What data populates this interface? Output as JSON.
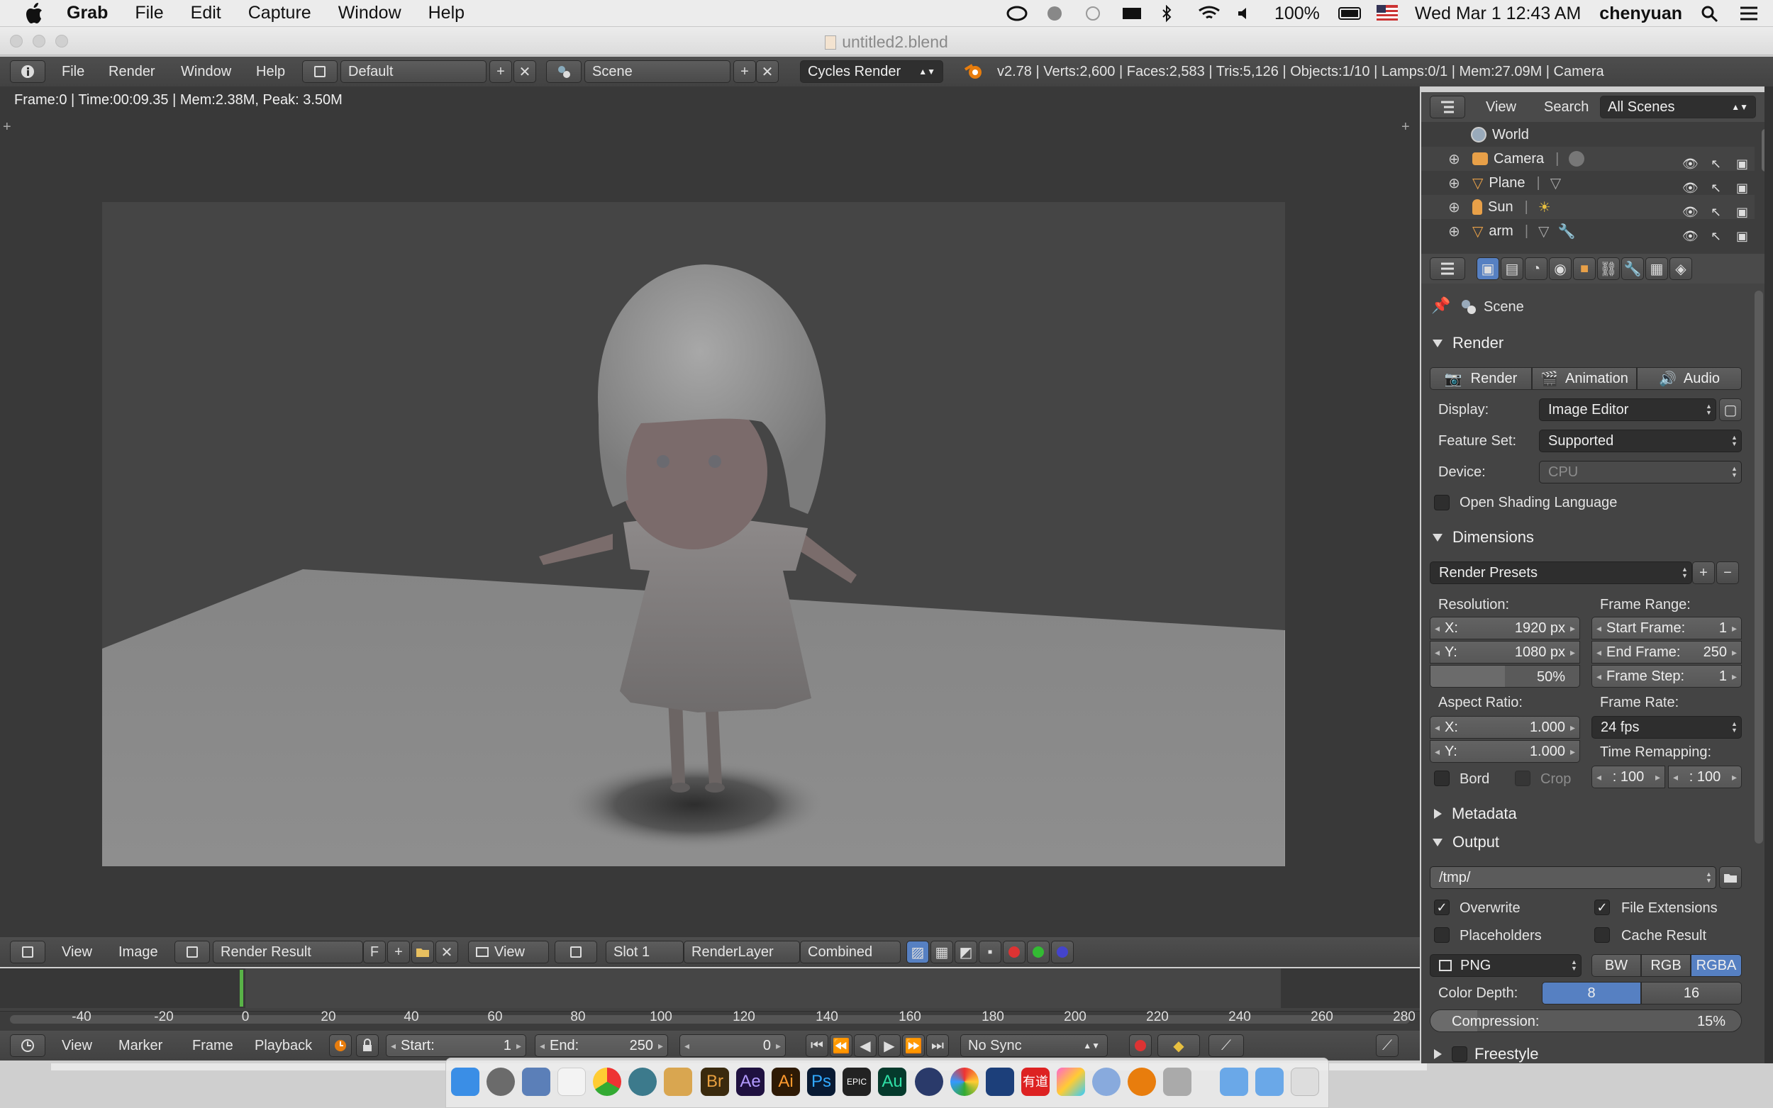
{
  "macos": {
    "app_name": "Grab",
    "menu": [
      "File",
      "Edit",
      "Capture",
      "Window",
      "Help"
    ],
    "battery": "100%",
    "datetime": "Wed Mar 1  12:43 AM",
    "user": "chenyuan"
  },
  "window": {
    "title": "untitled2.blend"
  },
  "info_header": {
    "menu": [
      "File",
      "Render",
      "Window",
      "Help"
    ],
    "layout": "Default",
    "scene": "Scene",
    "engine": "Cycles Render",
    "stats": "v2.78 | Verts:2,600 | Faces:2,583 | Tris:5,126 | Objects:1/10 | Lamps:0/1 | Mem:27.09M | Camera"
  },
  "viewport": {
    "render_info": "Frame:0 | Time:00:09.35 | Mem:2.38M, Peak: 3.50M"
  },
  "image_header": {
    "menu": [
      "View",
      "Image"
    ],
    "image_name": "Render Result",
    "fake_user": "F",
    "view": "View",
    "slot": "Slot 1",
    "layer": "RenderLayer",
    "pass": "Combined"
  },
  "outliner": {
    "header": {
      "view": "View",
      "search": "Search",
      "filter": "All Scenes"
    },
    "items": [
      {
        "label": "World"
      },
      {
        "label": "Camera"
      },
      {
        "label": "Plane"
      },
      {
        "label": "Sun"
      },
      {
        "label": "arm"
      }
    ]
  },
  "properties": {
    "context": "Scene",
    "render_panel": {
      "title": "Render",
      "buttons": [
        "Render",
        "Animation",
        "Audio"
      ],
      "display_label": "Display:",
      "display_value": "Image Editor",
      "feature_label": "Feature Set:",
      "feature_value": "Supported",
      "device_label": "Device:",
      "device_value": "CPU",
      "osl_label": "Open Shading Language"
    },
    "dimensions": {
      "title": "Dimensions",
      "presets": "Render Presets",
      "resolution_label": "Resolution:",
      "res_x_label": "X:",
      "res_x": "1920 px",
      "res_y_label": "Y:",
      "res_y": "1080 px",
      "res_percent": "50%",
      "frame_range_label": "Frame Range:",
      "start_label": "Start Frame:",
      "start": "1",
      "end_label": "End Frame:",
      "end": "250",
      "step_label": "Frame Step:",
      "step": "1",
      "aspect_label": "Aspect Ratio:",
      "asp_x_label": "X:",
      "asp_x": "1.000",
      "asp_y_label": "Y:",
      "asp_y": "1.000",
      "frame_rate_label": "Frame Rate:",
      "frame_rate": "24 fps",
      "remap_label": "Time Remapping:",
      "remap_old": ": 100",
      "remap_new": ": 100",
      "bord_label": "Bord",
      "crop_label": "Crop"
    },
    "metadata": {
      "title": "Metadata"
    },
    "output": {
      "title": "Output",
      "path": "/tmp/",
      "overwrite": "Overwrite",
      "file_ext": "File Extensions",
      "placeholders": "Placeholders",
      "cache": "Cache Result",
      "format": "PNG",
      "color_modes": [
        "BW",
        "RGB",
        "RGBA"
      ],
      "depth_label": "Color Depth:",
      "depths": [
        "8",
        "16"
      ],
      "compression_label": "Compression:",
      "compression_value": "15%",
      "compression_fraction": 0.15
    },
    "freestyle": {
      "title": "Freestyle"
    }
  },
  "timeline": {
    "ticks": [
      "-40",
      "-20",
      "0",
      "20",
      "40",
      "60",
      "80",
      "100",
      "120",
      "140",
      "160",
      "180",
      "200",
      "220",
      "240",
      "260",
      "280"
    ],
    "current_frame_marker": 0
  },
  "timeline_header": {
    "menu": [
      "View",
      "Marker",
      "Frame",
      "Playback"
    ],
    "start_label": "Start:",
    "start": "1",
    "end_label": "End:",
    "end": "250",
    "current": "0",
    "sync": "No Sync"
  },
  "colors": {
    "blender_bg": "#393939",
    "panel_bg": "#444444",
    "accent_blue": "#5680c2",
    "frame_green": "#59b347"
  }
}
